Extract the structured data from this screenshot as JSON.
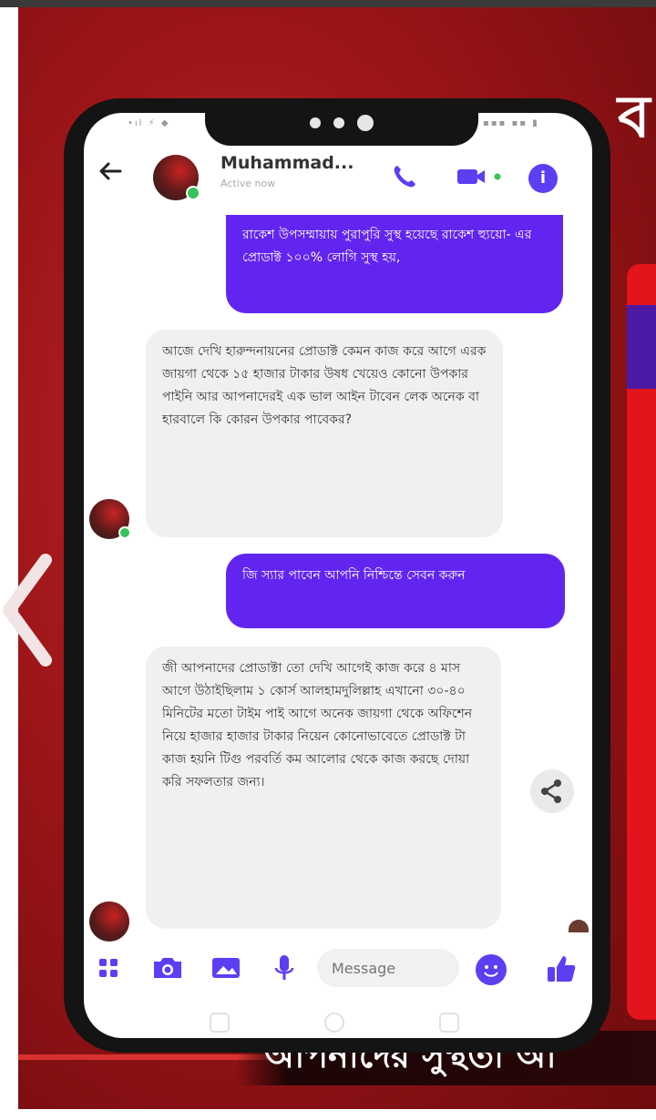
{
  "poster": {
    "corner_letter": "ব",
    "banner_text": "আপনাদের সুস্থতা আ"
  },
  "status_bar": {
    "left": "•ıl ⚡ ◆",
    "right": "▪▪▪ ▪▪ ▮"
  },
  "header": {
    "contact_name": "Muhammad...",
    "contact_status": "Active now",
    "info_label": "i"
  },
  "messages": [
    {
      "direction": "outgoing",
      "text": "রাকেশ উপসম্মায়ায় পুরাপুরি সুস্থ হয়েছে রাকেশ হ্যুয়ো- এর প্রোডাক্ট ১০০% লোগি সুস্থ হয়,"
    },
    {
      "direction": "incoming",
      "text": "আজে দেখি হারুন্দনায়নের প্রোডাক্ট কেমন কাজ করে আগে এরক জায়গা থেকে ১৫ হাজার টাকার উষধ খেয়েও কোনো উপকার পাইনি আর আপনাদেরই এক ভাল আইন টাবেন লেক অনেক বা হারবালে কি কোরন উপকার পাবেকর?"
    },
    {
      "direction": "outgoing",
      "text": "জি স্যার পাবেন আপনি নিশ্চিন্তে সেবন করুন"
    },
    {
      "direction": "incoming",
      "text": "জী আপনাদের প্রোডাক্টা তো দেখি আগেই কাজ করে ৪ মাস আগে উঠাইছিলাম ১ কোর্স আলহামদুলিল্লাহ এখানো ৩০-৪০ মিনিটের মতো টাইম পাই আগে অনেক জায়গা থেকে অফিশেন নিয়ে হাজার হাজার টাকার নিয়েন কোনোভাবেতে প্রোডাক্ট টা কাজ হয়নি টিগু পরবর্তি কম আলোর থেকে কাজ করছে দোয়া করি সফলতার জন্য।"
    }
  ],
  "composer": {
    "placeholder": "Message"
  },
  "colors": {
    "accent": "#6225f0",
    "icon_accent": "#5b3ff3",
    "poster_red": "#9c1518",
    "incoming_bubble": "#f0f0f0"
  },
  "icons": [
    "back-arrow-icon",
    "phone-icon",
    "video-icon",
    "info-icon",
    "share-icon",
    "apps-icon",
    "camera-icon",
    "gallery-icon",
    "microphone-icon",
    "emoji-icon",
    "thumbs-up-icon",
    "chevron-left-icon"
  ]
}
